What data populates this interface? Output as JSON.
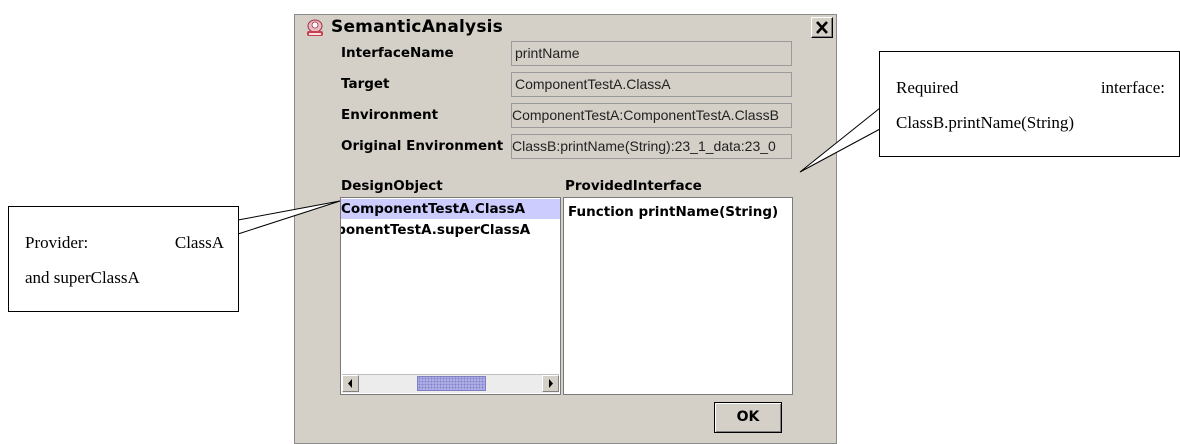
{
  "dialog": {
    "title": "SemanticAnalysis",
    "fields": [
      {
        "label": "InterfaceName",
        "value": "printName"
      },
      {
        "label": "Target",
        "value": "ComponentTestA.ClassA"
      },
      {
        "label": "Environment",
        "value": "ComponentTestA:ComponentTestA.ClassB"
      },
      {
        "label": "Original Environment",
        "value": "ClassB:printName(String):23_1_data:23_0"
      }
    ],
    "design_object": {
      "header": "DesignObject",
      "items": [
        "ComponentTestA.ClassA",
        "ComponentTestA.superClassA"
      ],
      "selected_index": 0
    },
    "provided_interface": {
      "header": "ProvidedInterface",
      "items": [
        "Function printName(String)"
      ]
    },
    "ok_label": "OK"
  },
  "callouts": {
    "provider": {
      "line1_a": "Provider:",
      "line1_b": "ClassA",
      "line2": "and superClassA"
    },
    "required": {
      "line1_a": "Required",
      "line1_b": "interface:",
      "line2": "ClassB.printName(String)"
    }
  }
}
